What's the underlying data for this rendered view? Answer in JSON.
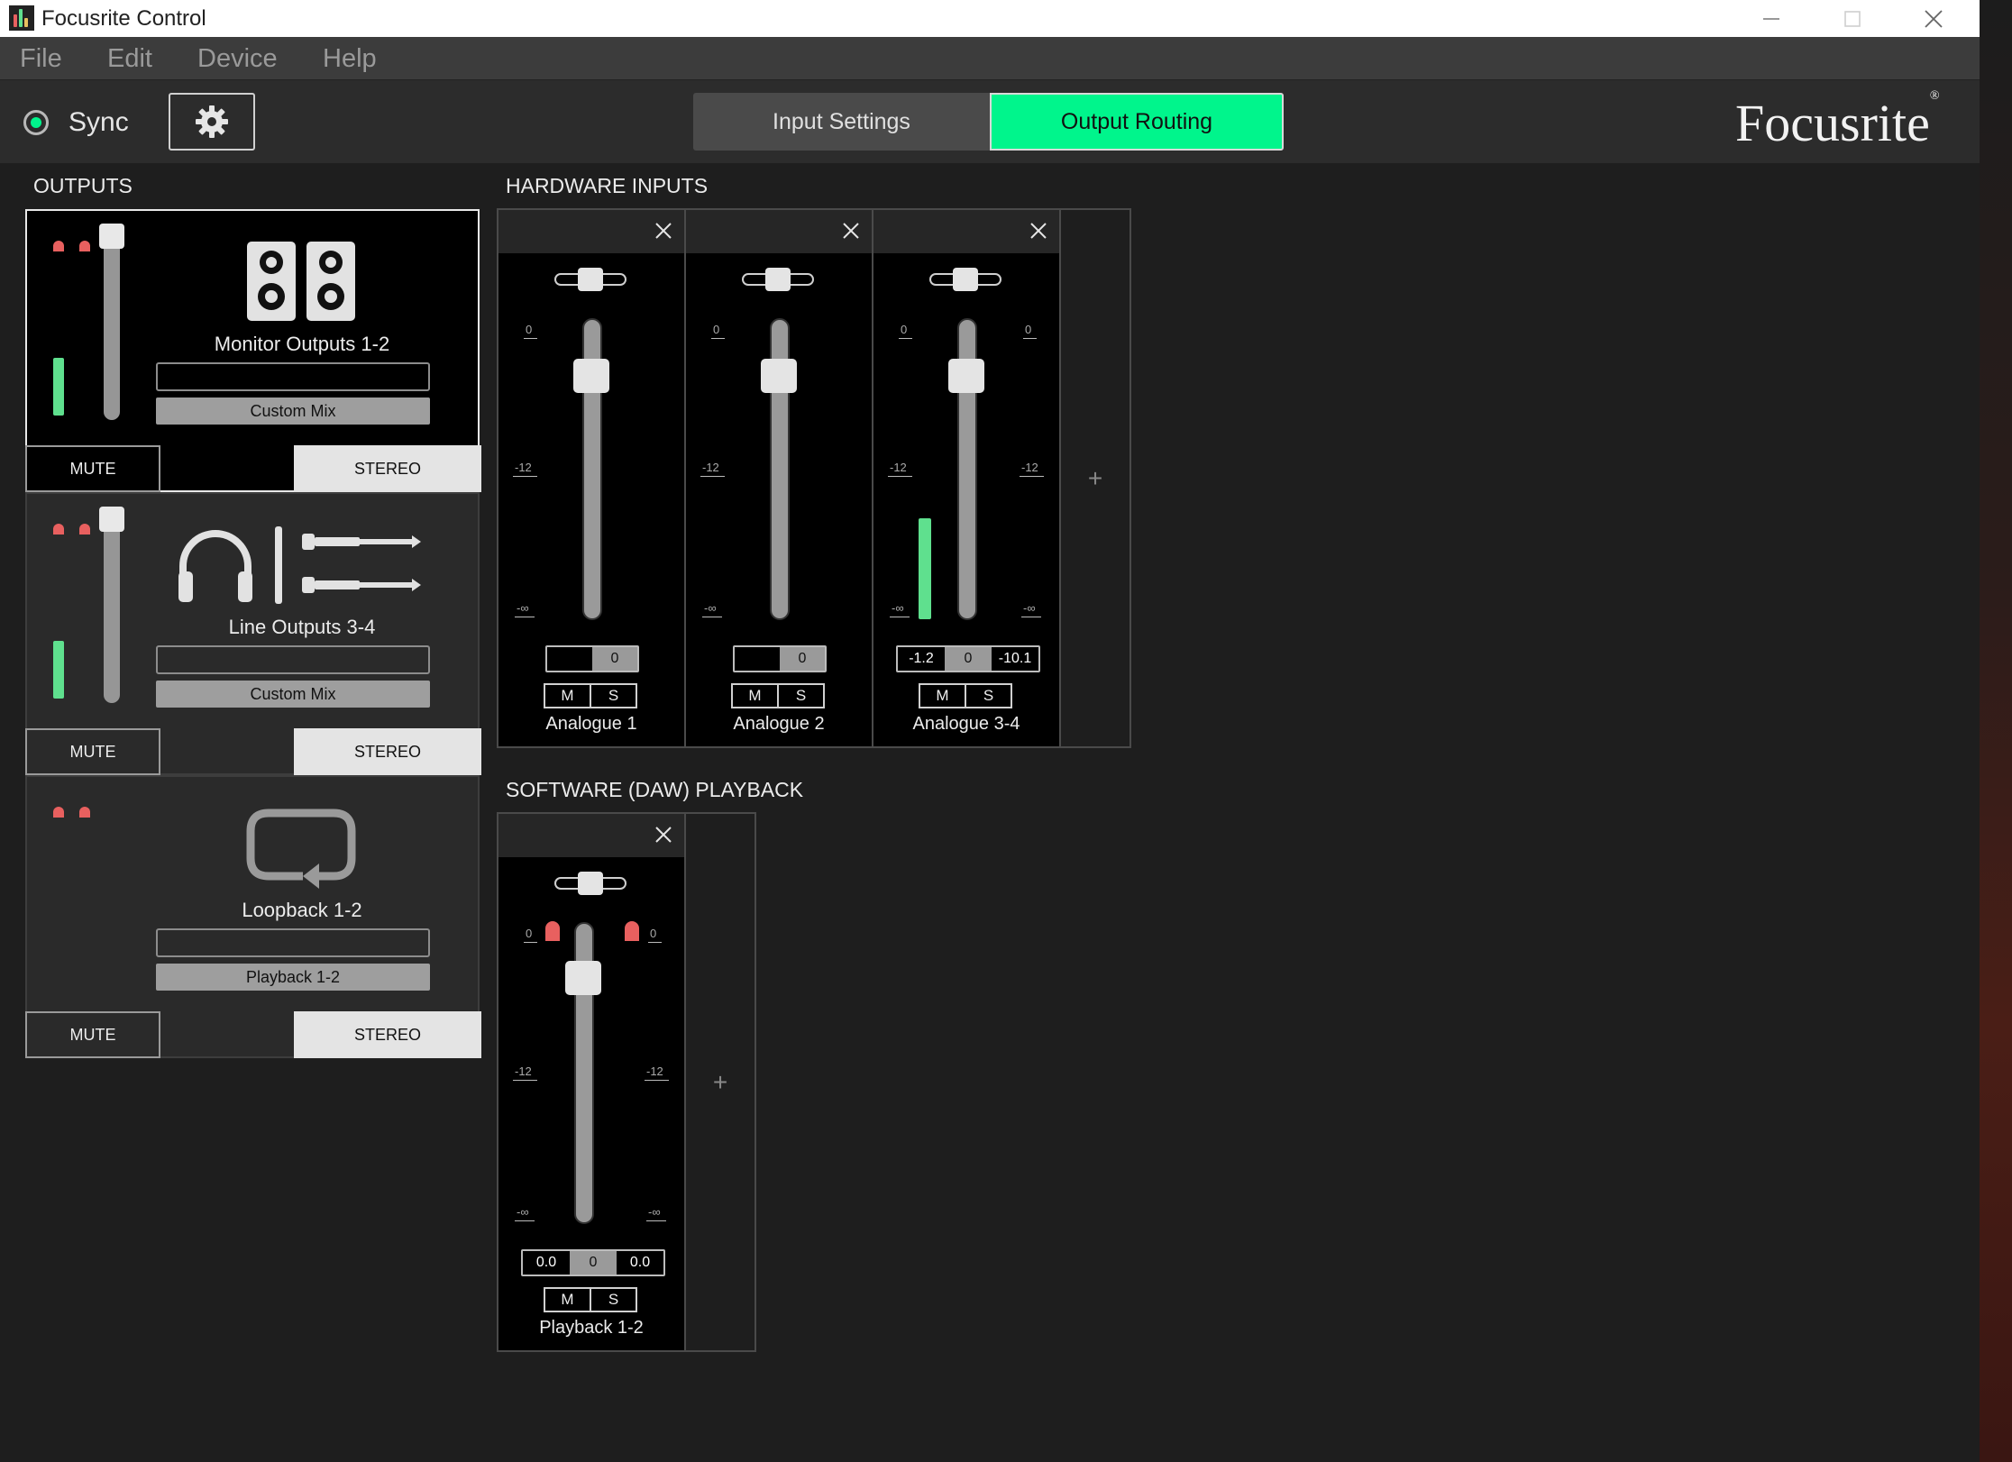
{
  "window": {
    "title": "Focusrite Control",
    "controls": {
      "minimize": "—",
      "maximize": "☐",
      "close": "✕"
    }
  },
  "menu": [
    {
      "label": "File"
    },
    {
      "label": "Edit"
    },
    {
      "label": "Device"
    },
    {
      "label": "Help"
    }
  ],
  "toolbar": {
    "sync_label": "Sync",
    "sync_color": "#00f58c",
    "settings_icon": "gear-icon",
    "tabs": [
      {
        "label": "Input Settings",
        "active": false
      },
      {
        "label": "Output Routing",
        "active": true
      }
    ],
    "logo": "Focusrite",
    "logo_mark": "®",
    "accent_color": "#00f58c"
  },
  "outputs": {
    "title": "OUTPUTS",
    "cards": [
      {
        "name": "Monitor Outputs 1-2",
        "icon": "monitor-speakers-icon",
        "mix": "Custom Mix",
        "mute": "MUTE",
        "mode": "STEREO",
        "selected": true
      },
      {
        "name": "Line Outputs 3-4",
        "icon": "headphones-line-icon",
        "mix": "Custom Mix",
        "mute": "MUTE",
        "mode": "STEREO",
        "selected": false
      },
      {
        "name": "Loopback 1-2",
        "icon": "loopback-icon",
        "mix": "Playback 1-2",
        "mute": "MUTE",
        "mode": "STEREO",
        "selected": false
      }
    ]
  },
  "hardware_inputs": {
    "title": "HARDWARE INPUTS",
    "scale": {
      "top": "0",
      "mid": "-12",
      "bottom": "-∞"
    },
    "add_label": "+",
    "strips": [
      {
        "name": "Analogue 1",
        "gain": [
          "",
          "0"
        ],
        "mute": "M",
        "solo": "S"
      },
      {
        "name": "Analogue 2",
        "gain": [
          "",
          "0"
        ],
        "mute": "M",
        "solo": "S"
      },
      {
        "name": "Analogue 3-4",
        "gain": [
          "-1.2",
          "0",
          "-10.1"
        ],
        "mute": "M",
        "solo": "S"
      }
    ]
  },
  "software_playback": {
    "title": "SOFTWARE (DAW) PLAYBACK",
    "scale": {
      "top": "0",
      "mid": "-12",
      "bottom": "-∞"
    },
    "add_label": "+",
    "strips": [
      {
        "name": "Playback 1-2",
        "gain": [
          "0.0",
          "0",
          "0.0"
        ],
        "mute": "M",
        "solo": "S"
      }
    ]
  }
}
